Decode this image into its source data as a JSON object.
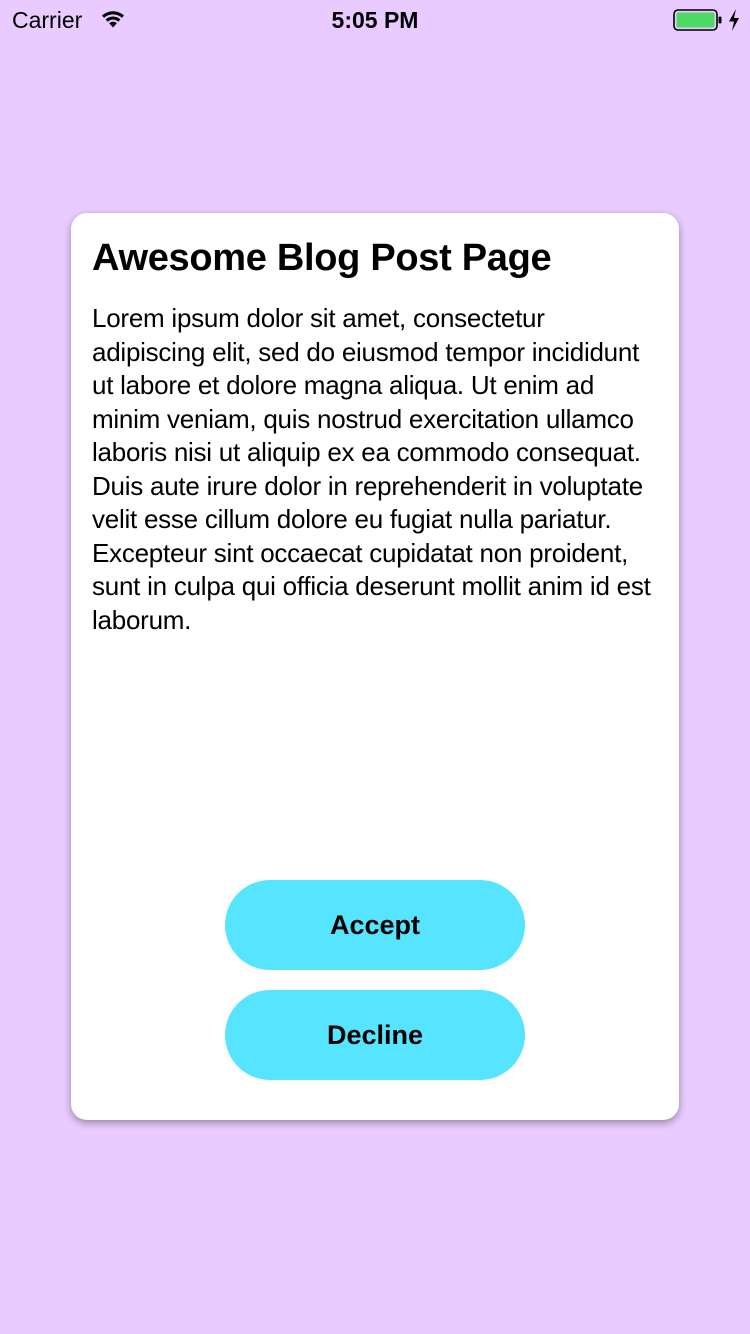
{
  "status_bar": {
    "carrier": "Carrier",
    "time": "5:05 PM",
    "icons": [
      "wifi-icon",
      "battery-icon",
      "charging-icon"
    ],
    "battery_color": "#4CD964"
  },
  "card": {
    "title": "Awesome Blog Post Page",
    "body": "Lorem ipsum dolor sit amet, consectetur adipiscing elit, sed do eiusmod tempor incididunt ut labore et dolore magna aliqua. Ut enim ad minim veniam, quis nostrud exercitation ullamco laboris nisi ut aliquip ex ea commodo consequat. Duis aute irure dolor in reprehenderit in voluptate velit esse cillum dolore eu fugiat nulla pariatur. Excepteur sint occaecat cupidatat non proident, sunt in culpa qui officia deserunt mollit anim id est laborum.",
    "accept_label": "Accept",
    "decline_label": "Decline"
  },
  "colors": {
    "background": "#E9CBFF",
    "card": "#FFFFFF",
    "button": "#57E4FF"
  }
}
